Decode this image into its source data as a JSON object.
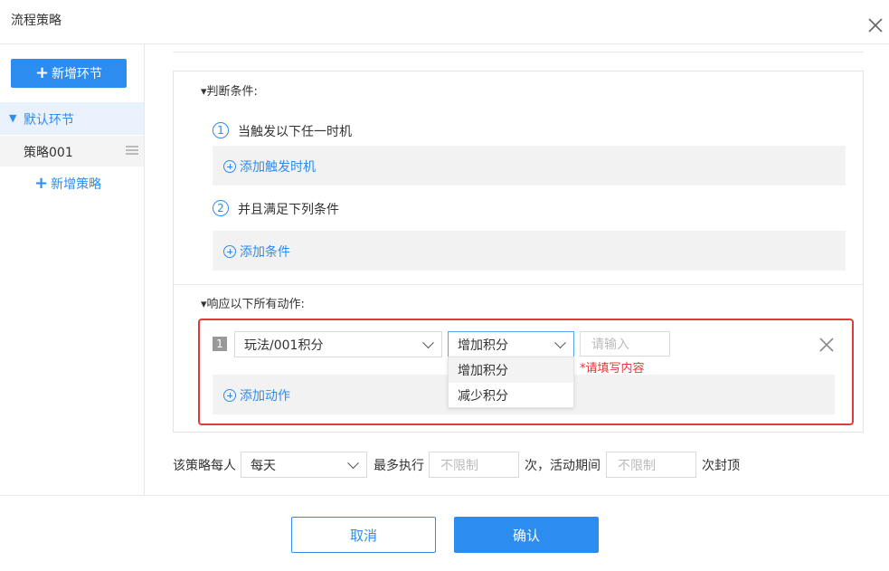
{
  "dialog": {
    "title": "流程策略"
  },
  "sidebar": {
    "add_stage_label": "新增环节",
    "stage_label": "默认环节",
    "policy_label": "策略001",
    "add_policy_label": "新增策略"
  },
  "conditions": {
    "section_title": "▾判断条件:",
    "step1_num": "1",
    "step1_label": "当触发以下任一时机",
    "add_trigger_label": "添加触发时机",
    "step2_num": "2",
    "step2_label": "并且满足下列条件",
    "add_condition_label": "添加条件"
  },
  "actions": {
    "section_title": "▾响应以下所有动作:",
    "row_index": "1",
    "target_select_value": "玩法/001积分",
    "op_select_value": "增加积分",
    "value_placeholder": "请输入",
    "error_text": "*请填写内容",
    "dropdown_options": [
      "增加积分",
      "减少积分"
    ],
    "add_action_label": "添加动作"
  },
  "limit": {
    "prefix": "该策略每人",
    "period_value": "每天",
    "max_exec_label": "最多执行",
    "max_exec_placeholder": "不限制",
    "middle_text": "次，活动期间",
    "cap_placeholder": "不限制",
    "suffix": "次封顶"
  },
  "footer": {
    "cancel_label": "取消",
    "confirm_label": "确认"
  },
  "colors": {
    "primary": "#2d8cf0",
    "error": "#e03a3a"
  }
}
